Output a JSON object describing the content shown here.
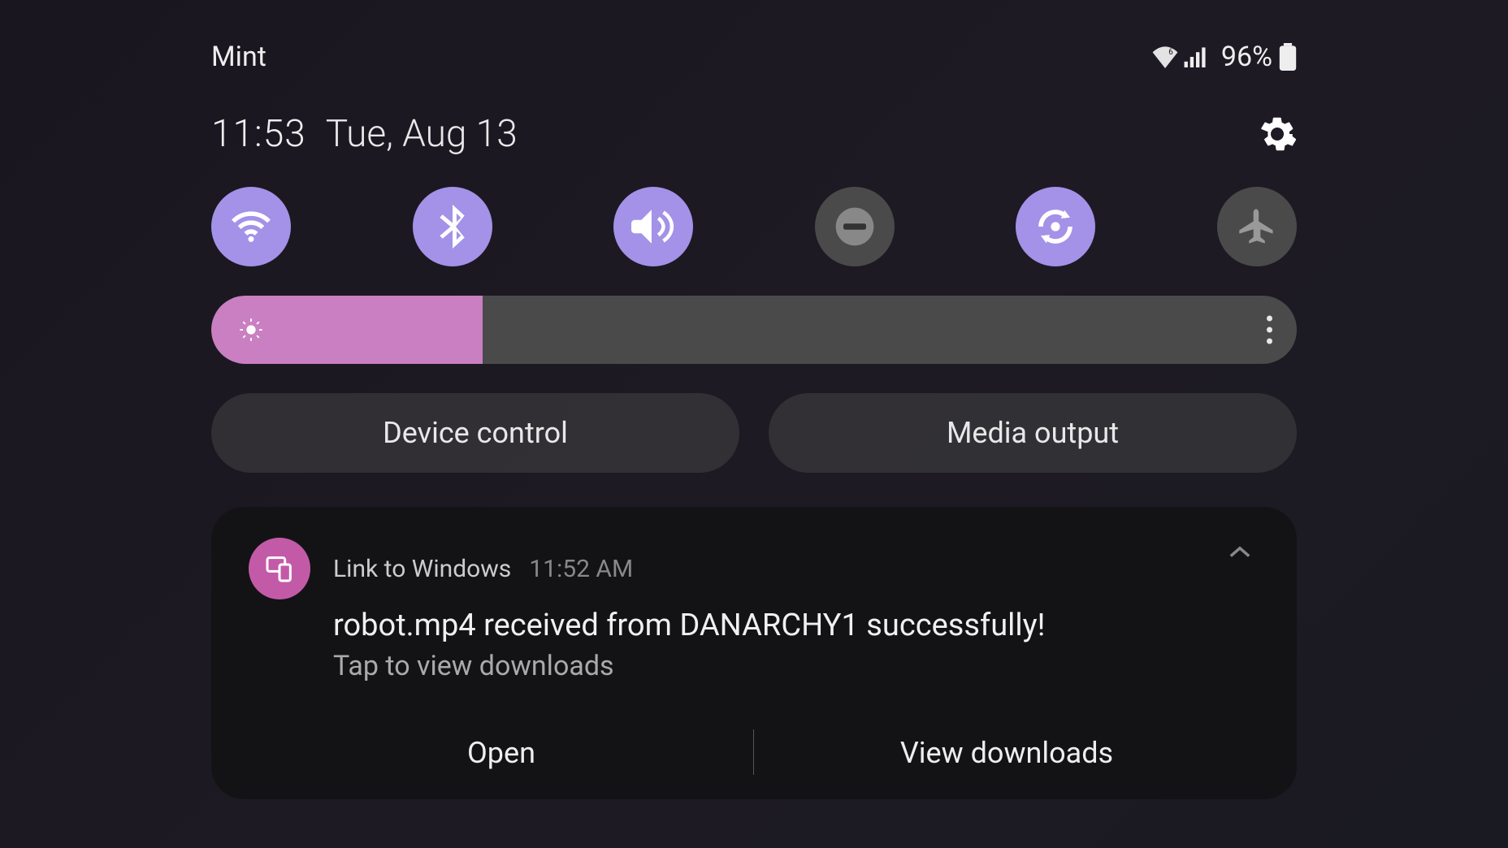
{
  "statusbar": {
    "carrier": "Mint",
    "battery_percent": "96%"
  },
  "header": {
    "time": "11:53",
    "date": "Tue, Aug 13"
  },
  "toggles": [
    {
      "name": "wifi",
      "on": true
    },
    {
      "name": "bluetooth",
      "on": true
    },
    {
      "name": "sound",
      "on": true
    },
    {
      "name": "dnd",
      "on": false
    },
    {
      "name": "rotate",
      "on": true
    },
    {
      "name": "airplane",
      "on": false
    }
  ],
  "brightness": {
    "percent": 25
  },
  "shortcuts": {
    "device_control": "Device control",
    "media_output": "Media output"
  },
  "notification": {
    "app": "Link to Windows",
    "time": "11:52 AM",
    "title": "robot.mp4 received from DANARCHY1 successfully!",
    "subtitle": "Tap to view downloads",
    "actions": {
      "open": "Open",
      "view_downloads": "View downloads"
    }
  },
  "colors": {
    "accent": "#a392e8",
    "pink": "#c97fc1",
    "magenta": "#c35aa8"
  }
}
